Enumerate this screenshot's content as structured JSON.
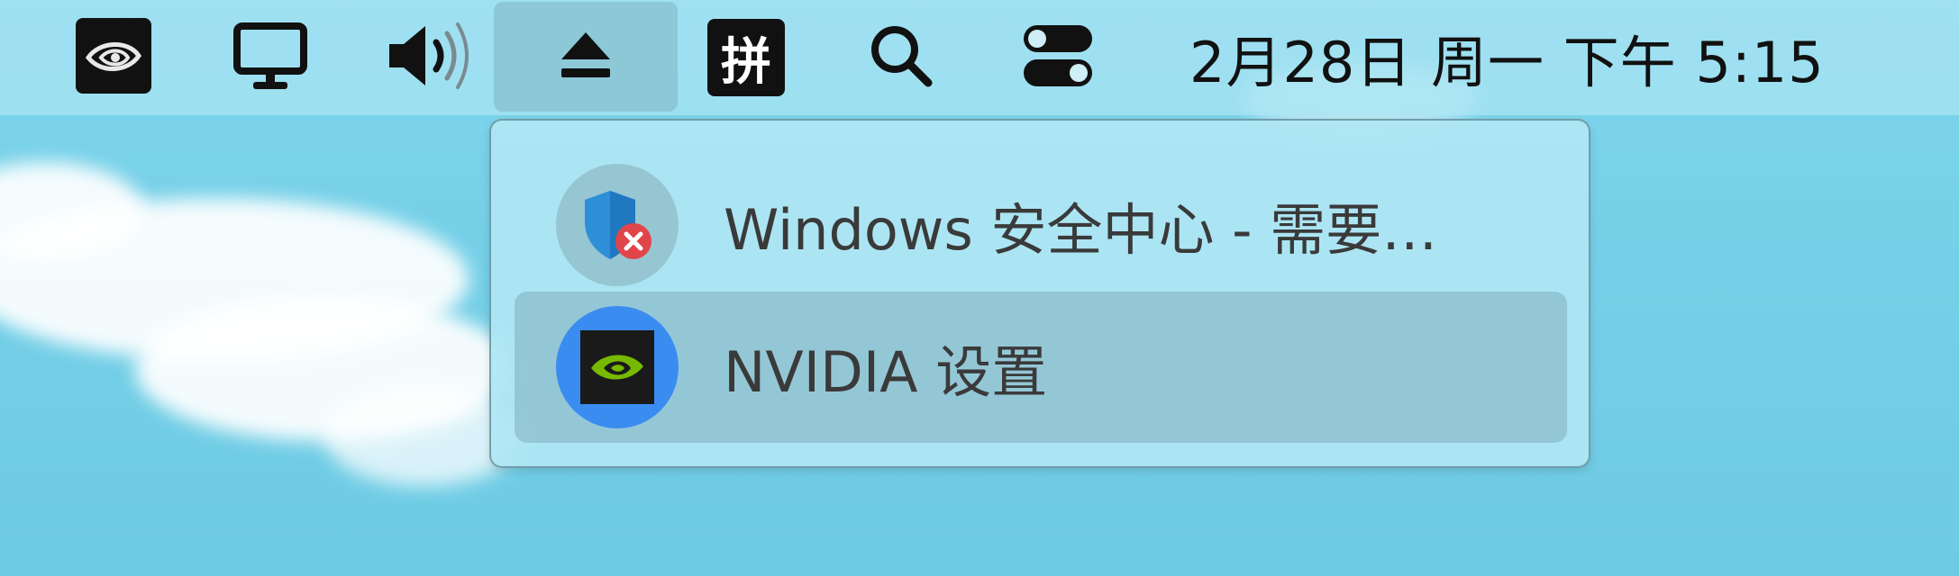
{
  "menubar": {
    "tray": [
      {
        "name": "nvidia-tray-icon"
      },
      {
        "name": "display-icon"
      },
      {
        "name": "volume-icon"
      },
      {
        "name": "eject-icon"
      },
      {
        "name": "input-method-icon",
        "label": "拼"
      },
      {
        "name": "search-icon"
      },
      {
        "name": "control-center-icon"
      }
    ],
    "clock": "2月28日 周一 下午 5:15"
  },
  "popup": {
    "items": [
      {
        "label": "Windows 安全中心 - 需要…",
        "icon": "windows-security-icon"
      },
      {
        "label": "NVIDIA 设置",
        "icon": "nvidia-settings-icon"
      }
    ]
  },
  "colors": {
    "desktop": "#75d0e8",
    "menubar": "#aae4f2",
    "popup": "#b0e6f3",
    "nvidia_green": "#76b900",
    "security_blue": "#2e8fd8",
    "error_red": "#e0454a"
  }
}
